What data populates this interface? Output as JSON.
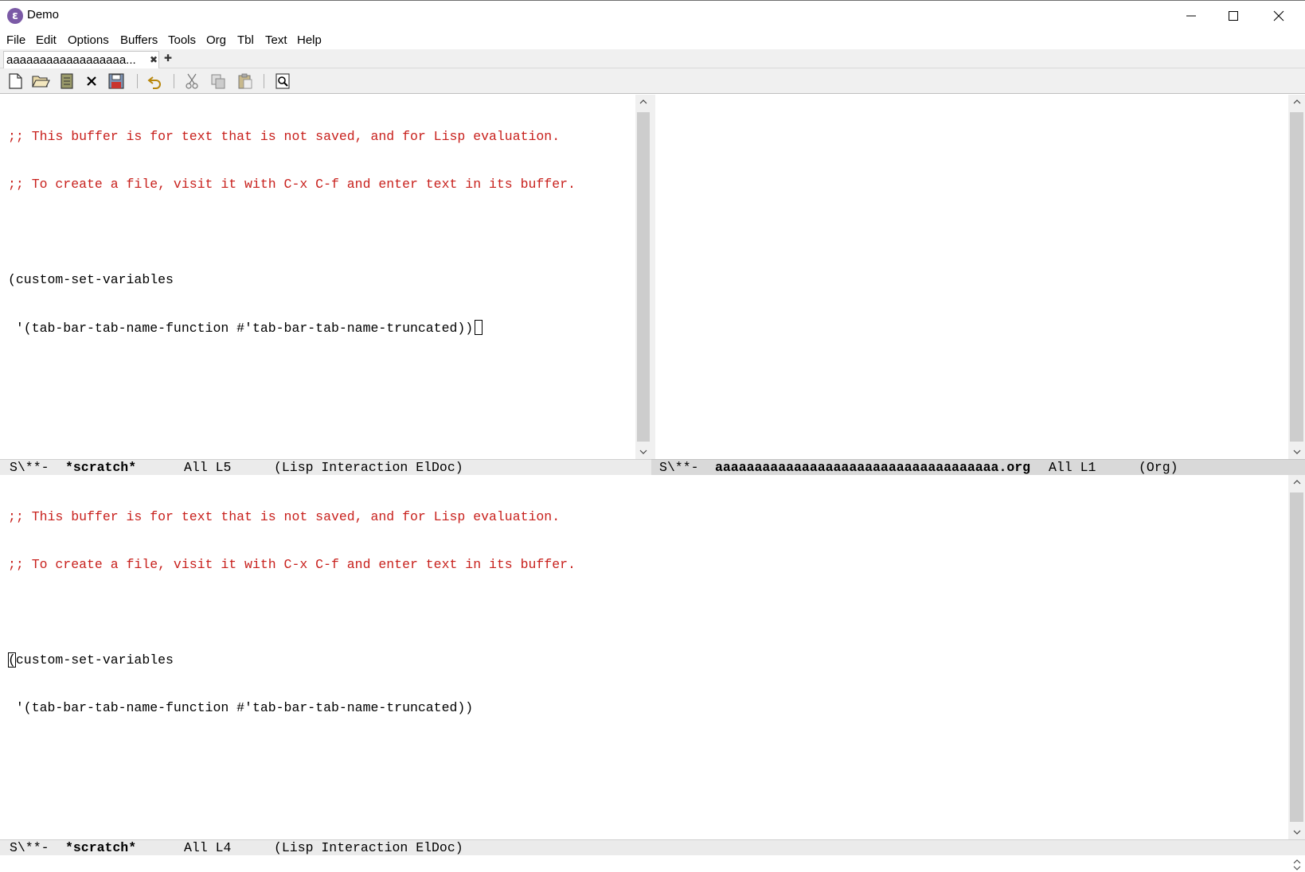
{
  "window": {
    "title": "Demo",
    "icon": "emacs-icon",
    "controls": [
      "minimize-icon",
      "maximize-icon",
      "close-icon"
    ]
  },
  "menubar": {
    "items": [
      "File",
      "Edit",
      "Options",
      "Buffers",
      "Tools",
      "Org",
      "Tbl",
      "Text",
      "Help"
    ]
  },
  "tabbar": {
    "tabs": [
      {
        "label": "aaaaaaaaaaaaaaaaaa...",
        "close_icon": "close-x-icon"
      }
    ],
    "new_tab_icon": "plus-icon"
  },
  "toolbar": {
    "buttons": [
      {
        "name": "new-file",
        "icon": "new-file-icon"
      },
      {
        "name": "open-file",
        "icon": "folder-open-icon"
      },
      {
        "name": "dired",
        "icon": "dired-icon"
      },
      {
        "name": "kill-buffer",
        "icon": "close-icon"
      },
      {
        "name": "save",
        "icon": "floppy-disk-icon"
      },
      {
        "name": "undo",
        "icon": "undo-icon"
      },
      {
        "name": "cut",
        "icon": "scissors-icon"
      },
      {
        "name": "copy",
        "icon": "copy-icon"
      },
      {
        "name": "paste",
        "icon": "paste-icon"
      },
      {
        "name": "search",
        "icon": "magnifier-icon"
      }
    ]
  },
  "windows": {
    "top_left": {
      "lines": [
        ";; This buffer is for text that is not saved, and for Lisp evaluation.",
        ";; To create a file, visit it with C-x C-f and enter text in its buffer.",
        "",
        "(custom-set-variables",
        " '(tab-bar-tab-name-function #'tab-bar-tab-name-truncated))"
      ],
      "modeline": {
        "status": "S\\**-",
        "buffer_name": "*scratch*",
        "position": "All L5",
        "modes": "(Lisp Interaction ElDoc)"
      }
    },
    "top_right": {
      "lines": [],
      "modeline": {
        "status": "S\\**-",
        "buffer_name": "aaaaaaaaaaaaaaaaaaaaaaaaaaaaaaaaaaaa.org",
        "position": "All L1",
        "modes": "(Org)"
      }
    },
    "bottom": {
      "lines": [
        ";; This buffer is for text that is not saved, and for Lisp evaluation.",
        ";; To create a file, visit it with C-x C-f and enter text in its buffer.",
        "",
        "(custom-set-variables",
        " '(tab-bar-tab-name-function #'tab-bar-tab-name-truncated))"
      ],
      "cursor_char": "(",
      "line4_rest": "custom-set-variables",
      "modeline": {
        "status": "S\\**-",
        "buffer_name": "*scratch*",
        "position": "All L4",
        "modes": "(Lisp Interaction ElDoc)"
      }
    }
  },
  "colors": {
    "comment": "#c8201c",
    "modeline_active": "#ebebeb",
    "modeline_inactive": "#d9d9d9",
    "scrollbar_thumb": "#cdcdcd"
  }
}
